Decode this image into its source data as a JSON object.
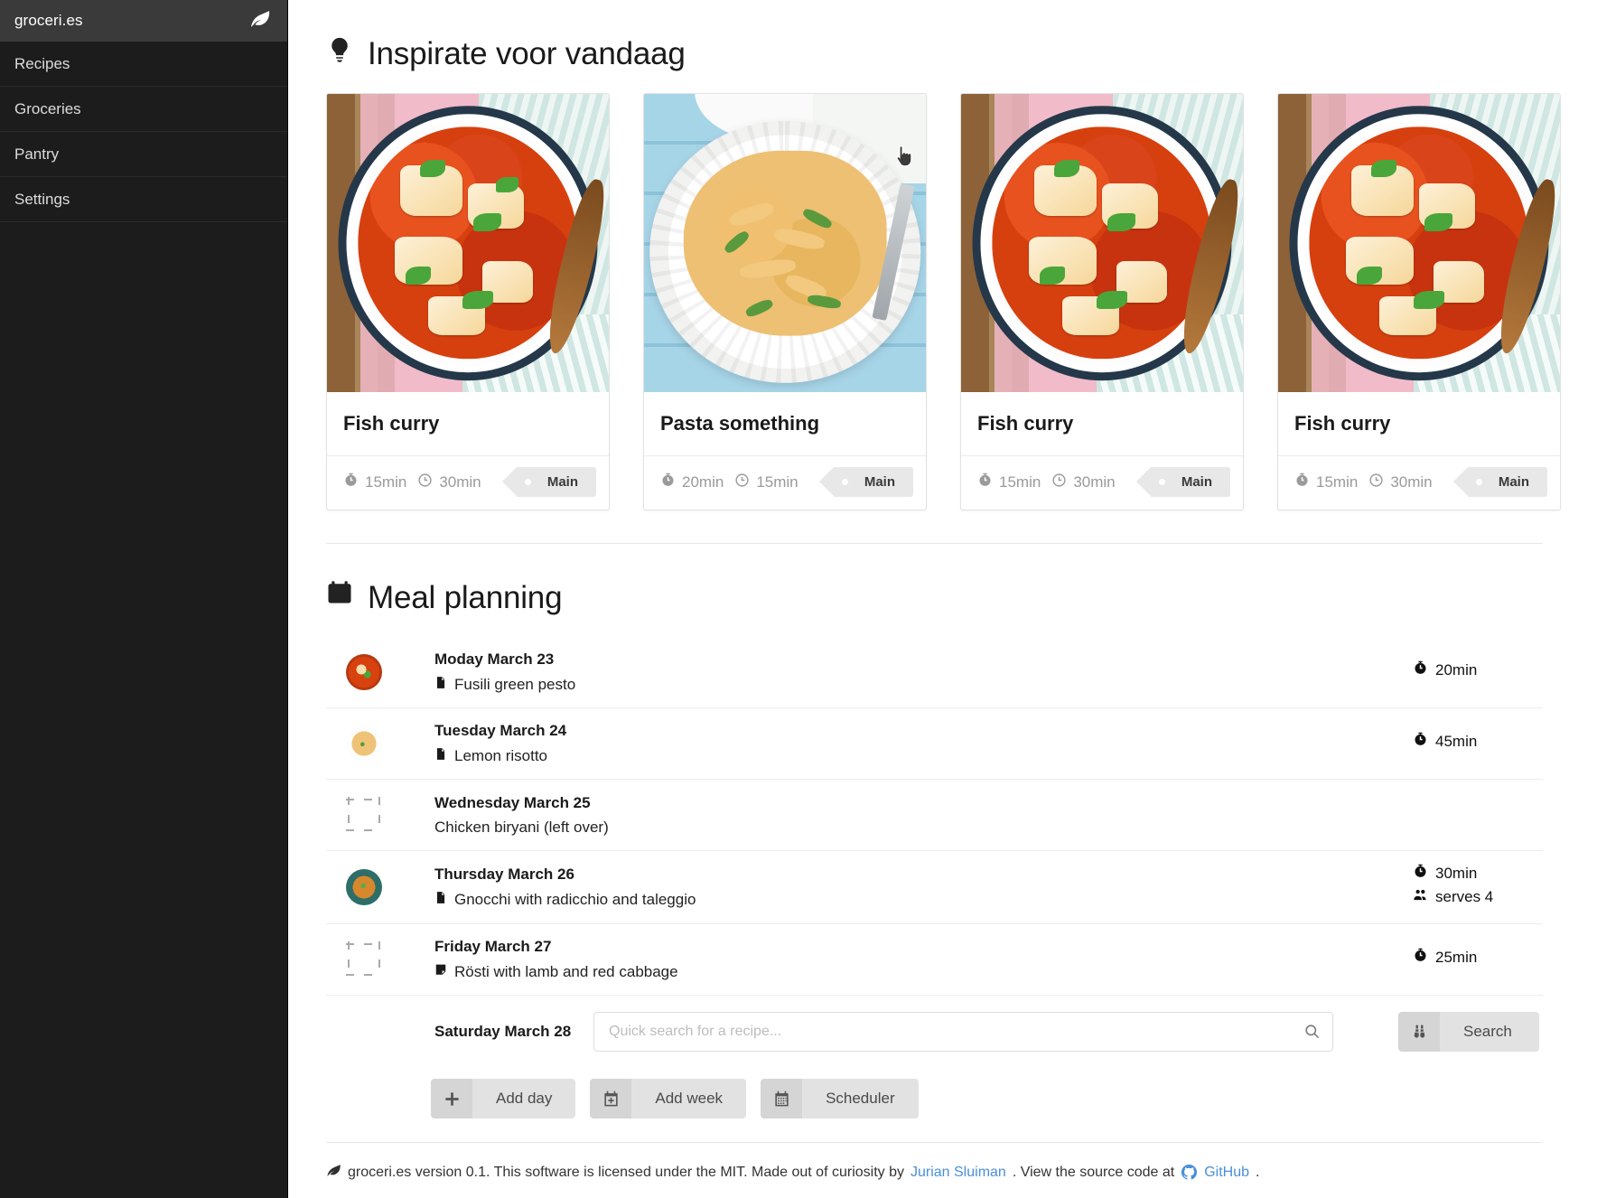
{
  "sidebar": {
    "brand": "groceri.es",
    "brand_icon": "leaf-icon",
    "items": [
      {
        "label": "Recipes"
      },
      {
        "label": "Groceries"
      },
      {
        "label": "Pantry"
      },
      {
        "label": "Settings"
      }
    ]
  },
  "inspiration": {
    "icon": "lightbulb-icon",
    "title": "Inspirate voor vandaag",
    "cards": [
      {
        "title": "Fish curry",
        "prep": "15min",
        "cook": "30min",
        "tag": "Main",
        "image": "fish-curry"
      },
      {
        "title": "Pasta something",
        "prep": "20min",
        "cook": "15min",
        "tag": "Main",
        "image": "pasta"
      },
      {
        "title": "Fish curry",
        "prep": "15min",
        "cook": "30min",
        "tag": "Main",
        "image": "fish-curry"
      },
      {
        "title": "Fish curry",
        "prep": "15min",
        "cook": "30min",
        "tag": "Main",
        "image": "fish-curry"
      }
    ]
  },
  "meal_planning": {
    "icon": "calendar-icon",
    "title": "Meal planning",
    "rows": [
      {
        "day": "Moday March 23",
        "recipe": "Fusili green pesto",
        "recipe_icon": "document-icon",
        "thumb": "curry-t",
        "time": "20min",
        "serves": ""
      },
      {
        "day": "Tuesday March 24",
        "recipe": "Lemon risotto",
        "recipe_icon": "document-icon",
        "thumb": "pasta-t",
        "time": "45min",
        "serves": ""
      },
      {
        "day": "Wednesday March 25",
        "recipe": "Chicken biryani (left over)",
        "recipe_icon": "",
        "thumb": "",
        "time": "",
        "serves": ""
      },
      {
        "day": "Thursday March 26",
        "recipe": "Gnocchi with radicchio and taleggio",
        "recipe_icon": "document-icon",
        "thumb": "gnocchi-t",
        "time": "30min",
        "serves": "serves 4"
      },
      {
        "day": "Friday March 27",
        "recipe": "Rösti with lamb and red cabbage",
        "recipe_icon": "sticky-note-icon",
        "thumb": "",
        "time": "25min",
        "serves": ""
      }
    ],
    "search_row": {
      "day": "Saturday March 28",
      "placeholder": "Quick search for a recipe...",
      "value": "",
      "search_button": "Search",
      "search_button_icon": "binoculars-icon",
      "input_icon": "magnifier-icon"
    },
    "actions": [
      {
        "label": "Add day",
        "icon": "plus-icon"
      },
      {
        "label": "Add week",
        "icon": "calendar-plus-icon"
      },
      {
        "label": "Scheduler",
        "icon": "calendar-grid-icon"
      }
    ]
  },
  "footer": {
    "icon": "leaf-icon",
    "text_before": "groceri.es version 0.1. This software is licensed under the MIT. Made out of curiosity by ",
    "author_link": "Jurian Sluiman",
    "text_middle": ". View the source code at ",
    "github_link": "GitHub",
    "text_after": "."
  },
  "colors": {
    "sidebar_bg": "#1c1c1c",
    "sidebar_brand_bg": "#3a3a3a",
    "link": "#4a90d9",
    "muted": "#9a9a9a",
    "button_bg": "#e2e2e2"
  }
}
